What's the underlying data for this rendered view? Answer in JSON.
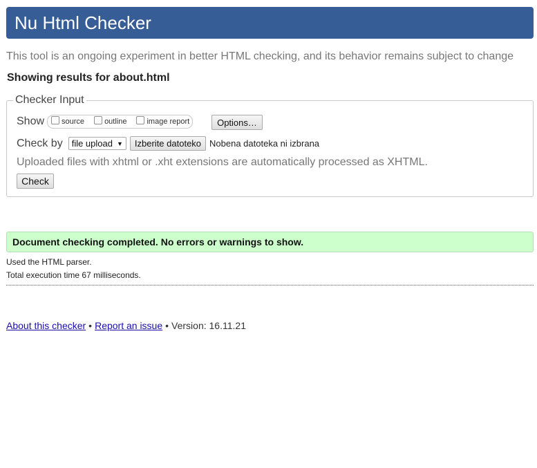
{
  "header": {
    "title": "Nu Html Checker"
  },
  "intro_text": "This tool is an ongoing experiment in better HTML checking, and its behavior remains subject to change",
  "results_heading": "Showing results for about.html",
  "checker_input": {
    "legend": "Checker Input",
    "show_label": "Show",
    "show_options": [
      {
        "label": "source",
        "checked": false
      },
      {
        "label": "outline",
        "checked": false
      },
      {
        "label": "image report",
        "checked": false
      }
    ],
    "options_button": "Options…",
    "check_by_label": "Check by",
    "check_by_selected": "file upload",
    "choose_file_button": "Izberite datoteko",
    "file_status": "Nobena datoteka ni izbrana",
    "upload_note": "Uploaded files with xhtml or .xht extensions are automatically processed as XHTML.",
    "check_button": "Check"
  },
  "result": {
    "success_message": "Document checking completed. No errors or warnings to show.",
    "parser_note": "Used the HTML parser.",
    "execution_time": "Total execution time 67 milliseconds."
  },
  "footer": {
    "about_link": "About this checker",
    "separator": "•",
    "report_link": "Report an issue",
    "version": "Version: 16.11.21"
  },
  "colors": {
    "header_bg": "#365d95",
    "success_bg": "#ccffcc",
    "link": "#1a0dab"
  }
}
